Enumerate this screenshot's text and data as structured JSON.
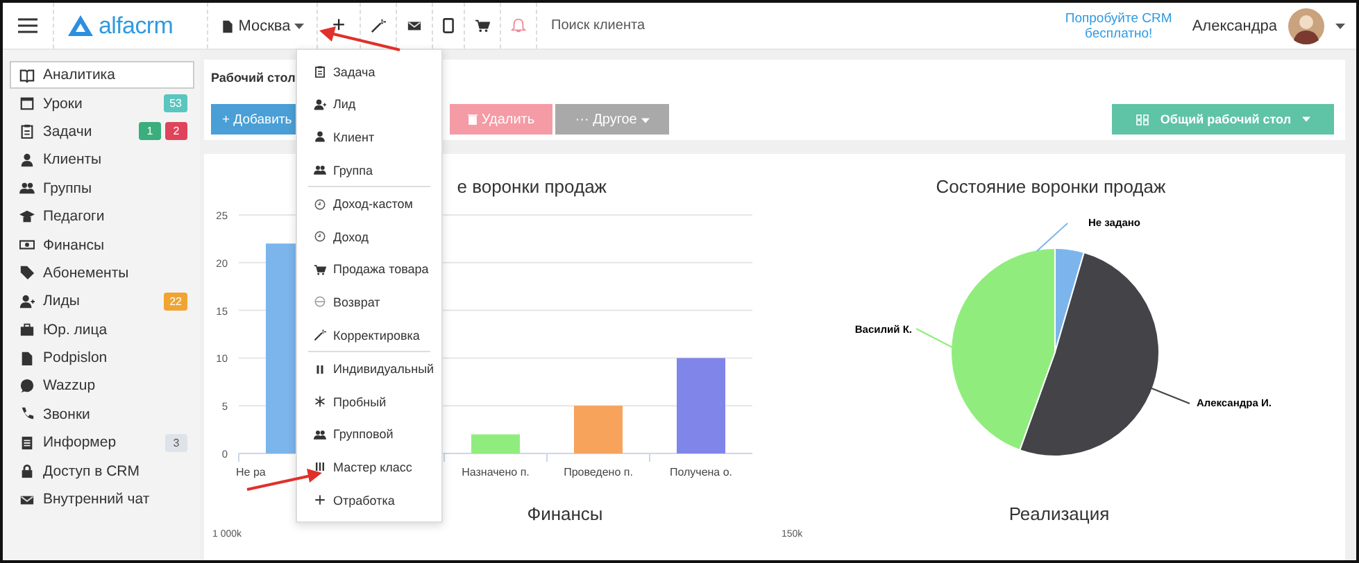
{
  "topbar": {
    "logo": "alfacrm",
    "branch": "Москва",
    "add_button": "+",
    "search": {
      "placeholder": "Поиск клиента"
    },
    "promo": "Попробуйте CRM бесплатно!",
    "user": "Александра"
  },
  "sidebar": {
    "items": [
      {
        "label": "Аналитика",
        "selected": true
      },
      {
        "label": "Уроки",
        "selected": false,
        "badges": [
          {
            "text": "53",
            "color": "#5bc5bf"
          }
        ]
      },
      {
        "label": "Задачи",
        "selected": false,
        "badges": [
          {
            "text": "1",
            "color": "#3aae7c"
          },
          {
            "text": "2",
            "color": "#e0445a"
          }
        ]
      },
      {
        "label": "Клиенты",
        "selected": false
      },
      {
        "label": "Группы",
        "selected": false
      },
      {
        "label": "Педагоги",
        "selected": false
      },
      {
        "label": "Финансы",
        "selected": false
      },
      {
        "label": "Абонементы",
        "selected": false
      },
      {
        "label": "Лиды",
        "selected": false,
        "badges": [
          {
            "text": "22",
            "color": "#f0a431"
          }
        ]
      },
      {
        "label": "Юр. лица",
        "selected": false
      },
      {
        "label": "Podpislon",
        "selected": false
      },
      {
        "label": "Wazzup",
        "selected": false
      },
      {
        "label": "Звонки",
        "selected": false
      },
      {
        "label": "Информер",
        "selected": false,
        "badges": [
          {
            "text": "3",
            "color": "#dde3e8"
          }
        ]
      },
      {
        "label": "Доступ в CRM",
        "selected": false
      },
      {
        "label": "Внутренний чат",
        "selected": false
      }
    ]
  },
  "dashboard": {
    "title": "Рабочий стол",
    "buttons": [
      {
        "label": "+ Добавить",
        "kind": "primary"
      },
      {
        "label": "Удалить",
        "kind": "danger"
      },
      {
        "label": "··· Другое",
        "kind": "default"
      }
    ],
    "workspace_button": "Общий рабочий стол"
  },
  "add_menu": {
    "groups": [
      {
        "items": [
          "Задача",
          "Лид",
          "Клиент",
          "Группа"
        ]
      },
      {
        "items": [
          "Доход-кастом",
          "Доход",
          "Продажа товара",
          "Возврат",
          "Корректировка"
        ]
      },
      {
        "items": [
          "Индивидуальный",
          "Пробный",
          "Групповой",
          "Мастер класс",
          "Отработка"
        ]
      }
    ]
  },
  "funnel": {
    "chart_data": {
      "type": "bar",
      "title": "е воронки продаж",
      "categories": [
        "Не ра",
        null,
        "Назначено п.",
        "Проведено п.",
        "Получена о."
      ],
      "values": [
        22,
        null,
        2,
        5,
        10
      ],
      "grid": true,
      "ylim": [
        0,
        25
      ],
      "yticks": [
        0,
        5,
        10,
        15,
        20,
        25
      ]
    }
  },
  "funnel_state": {
    "chart_data": {
      "type": "pie",
      "title": "Состояние воронки продаж",
      "categories": [
        "Не задано",
        "Александра И.",
        "Василий К."
      ],
      "values": [
        0.045,
        0.51,
        0.445
      ]
    }
  },
  "lower_charts": [
    {
      "title": "Финансы",
      "tick": "1 000k"
    },
    {
      "title": "Реализация",
      "tick": "150k"
    }
  ]
}
